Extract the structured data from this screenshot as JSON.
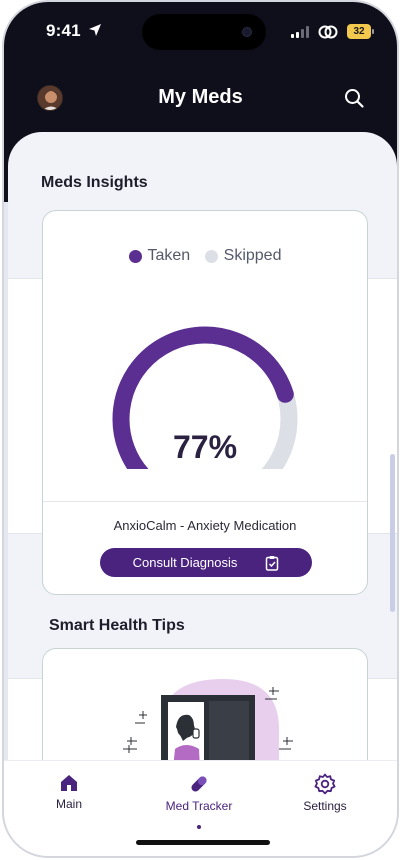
{
  "status_bar": {
    "time": "9:41",
    "battery": "32"
  },
  "header": {
    "title": "My Meds"
  },
  "insights": {
    "section_title": "Meds Insights",
    "legend": [
      {
        "label": "Taken",
        "color": "#5b2e91"
      },
      {
        "label": "Skipped",
        "color": "#dcdfe6"
      }
    ],
    "percent_label": "77%",
    "taken_fraction": 0.77,
    "medication": "AnxioCalm - Anxiety Medication",
    "consult_label": "Consult Diagnosis"
  },
  "tips": {
    "section_title": "Smart Health Tips"
  },
  "tabbar": {
    "items": [
      {
        "label": "Main",
        "icon": "home-icon"
      },
      {
        "label": "Med Tracker",
        "icon": "pill-icon",
        "active": true
      },
      {
        "label": "Settings",
        "icon": "gear-icon"
      }
    ]
  },
  "colors": {
    "accent": "#4a237f",
    "header_bg": "#0f0f1c",
    "skipped": "#dcdfe6"
  }
}
